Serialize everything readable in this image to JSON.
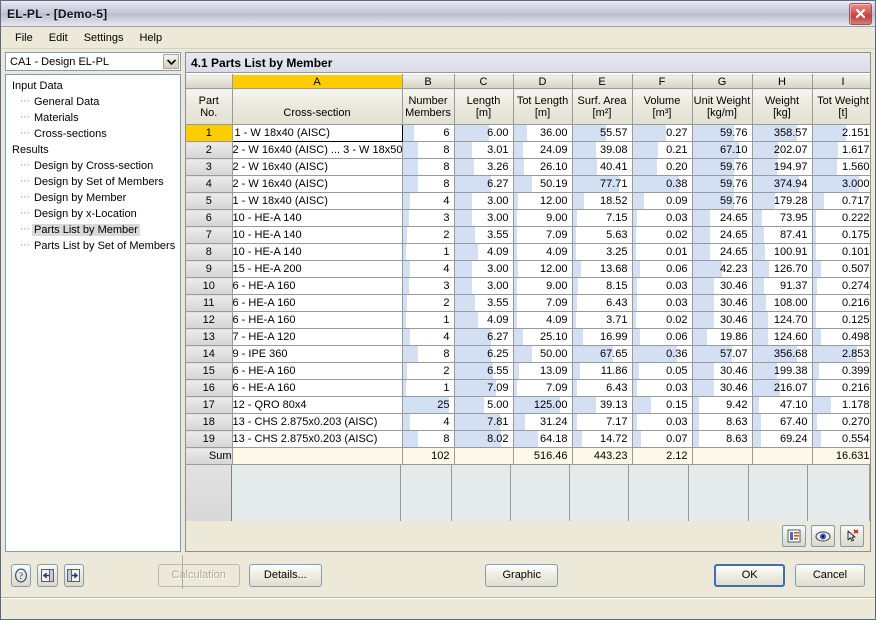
{
  "window": {
    "title": "EL-PL - [Demo-5]",
    "close_icon": "close-icon"
  },
  "menu": {
    "items": [
      "File",
      "Edit",
      "Settings",
      "Help"
    ]
  },
  "sidebar": {
    "combo": {
      "value": "CA1 - Design EL-PL",
      "arrow_icon": "chevron-down-icon"
    },
    "tree": [
      {
        "label": "Input Data",
        "level": 0,
        "selected": false
      },
      {
        "label": "General Data",
        "level": 1,
        "selected": false
      },
      {
        "label": "Materials",
        "level": 1,
        "selected": false
      },
      {
        "label": "Cross-sections",
        "level": 1,
        "selected": false
      },
      {
        "label": "Results",
        "level": 0,
        "selected": false
      },
      {
        "label": "Design by Cross-section",
        "level": 1,
        "selected": false
      },
      {
        "label": "Design by Set of Members",
        "level": 1,
        "selected": false
      },
      {
        "label": "Design by Member",
        "level": 1,
        "selected": false
      },
      {
        "label": "Design by x-Location",
        "level": 1,
        "selected": false
      },
      {
        "label": "Parts List by Member",
        "level": 1,
        "selected": true
      },
      {
        "label": "Parts List by Set of Members",
        "level": 1,
        "selected": false
      }
    ]
  },
  "panel": {
    "header": "4.1 Parts List by Member",
    "toolbar": [
      {
        "name": "print-report-icon"
      },
      {
        "name": "eye-icon"
      },
      {
        "name": "select-cursor-icon"
      }
    ]
  },
  "table": {
    "column_letters": [
      "",
      "A",
      "B",
      "C",
      "D",
      "E",
      "F",
      "G",
      "H",
      "I"
    ],
    "highlight_letter": "A",
    "row_header_title": [
      "Part",
      "No."
    ],
    "headers": [
      {
        "line1": "Cross-section",
        "line2": ""
      },
      {
        "line1": "Number",
        "line2": "Members"
      },
      {
        "line1": "Length",
        "line2": "[m]"
      },
      {
        "line1": "Tot Length",
        "line2": "[m]"
      },
      {
        "line1": "Surf. Area",
        "line2": "[m²]"
      },
      {
        "line1": "Volume",
        "line2": "[m³]"
      },
      {
        "line1": "Unit Weight",
        "line2": "[kg/m]"
      },
      {
        "line1": "Weight",
        "line2": "[kg]"
      },
      {
        "line1": "Tot Weight",
        "line2": "[t]"
      }
    ],
    "rows": [
      {
        "no": "1",
        "cross_section": "1 - W 18x40 (AISC)",
        "number_members": "6",
        "length": "6.00",
        "tot_length": "36.00",
        "surf_area": "55.57",
        "volume": "0.27",
        "unit_weight": "59.76",
        "weight": "358.57",
        "tot_weight": "2.151",
        "active": true
      },
      {
        "no": "2",
        "cross_section": "2 - W 16x40 (AISC) ... 3 - W 18x50",
        "number_members": "8",
        "length": "3.01",
        "tot_length": "24.09",
        "surf_area": "39.08",
        "volume": "0.21",
        "unit_weight": "67.10",
        "weight": "202.07",
        "tot_weight": "1.617",
        "active": false
      },
      {
        "no": "3",
        "cross_section": "2 - W 16x40 (AISC)",
        "number_members": "8",
        "length": "3.26",
        "tot_length": "26.10",
        "surf_area": "40.41",
        "volume": "0.20",
        "unit_weight": "59.76",
        "weight": "194.97",
        "tot_weight": "1.560",
        "active": false
      },
      {
        "no": "4",
        "cross_section": "2 - W 16x40 (AISC)",
        "number_members": "8",
        "length": "6.27",
        "tot_length": "50.19",
        "surf_area": "77.71",
        "volume": "0.38",
        "unit_weight": "59.76",
        "weight": "374.94",
        "tot_weight": "3.000",
        "active": false
      },
      {
        "no": "5",
        "cross_section": "1 - W 18x40 (AISC)",
        "number_members": "4",
        "length": "3.00",
        "tot_length": "12.00",
        "surf_area": "18.52",
        "volume": "0.09",
        "unit_weight": "59.76",
        "weight": "179.28",
        "tot_weight": "0.717",
        "active": false
      },
      {
        "no": "6",
        "cross_section": "10 - HE-A 140",
        "number_members": "3",
        "length": "3.00",
        "tot_length": "9.00",
        "surf_area": "7.15",
        "volume": "0.03",
        "unit_weight": "24.65",
        "weight": "73.95",
        "tot_weight": "0.222",
        "active": false
      },
      {
        "no": "7",
        "cross_section": "10 - HE-A 140",
        "number_members": "2",
        "length": "3.55",
        "tot_length": "7.09",
        "surf_area": "5.63",
        "volume": "0.02",
        "unit_weight": "24.65",
        "weight": "87.41",
        "tot_weight": "0.175",
        "active": false
      },
      {
        "no": "8",
        "cross_section": "10 - HE-A 140",
        "number_members": "1",
        "length": "4.09",
        "tot_length": "4.09",
        "surf_area": "3.25",
        "volume": "0.01",
        "unit_weight": "24.65",
        "weight": "100.91",
        "tot_weight": "0.101",
        "active": false
      },
      {
        "no": "9",
        "cross_section": "15 - HE-A 200",
        "number_members": "4",
        "length": "3.00",
        "tot_length": "12.00",
        "surf_area": "13.68",
        "volume": "0.06",
        "unit_weight": "42.23",
        "weight": "126.70",
        "tot_weight": "0.507",
        "active": false
      },
      {
        "no": "10",
        "cross_section": "6 - HE-A 160",
        "number_members": "3",
        "length": "3.00",
        "tot_length": "9.00",
        "surf_area": "8.15",
        "volume": "0.03",
        "unit_weight": "30.46",
        "weight": "91.37",
        "tot_weight": "0.274",
        "active": false
      },
      {
        "no": "11",
        "cross_section": "6 - HE-A 160",
        "number_members": "2",
        "length": "3.55",
        "tot_length": "7.09",
        "surf_area": "6.43",
        "volume": "0.03",
        "unit_weight": "30.46",
        "weight": "108.00",
        "tot_weight": "0.216",
        "active": false
      },
      {
        "no": "12",
        "cross_section": "6 - HE-A 160",
        "number_members": "1",
        "length": "4.09",
        "tot_length": "4.09",
        "surf_area": "3.71",
        "volume": "0.02",
        "unit_weight": "30.46",
        "weight": "124.70",
        "tot_weight": "0.125",
        "active": false
      },
      {
        "no": "13",
        "cross_section": "7 - HE-A 120",
        "number_members": "4",
        "length": "6.27",
        "tot_length": "25.10",
        "surf_area": "16.99",
        "volume": "0.06",
        "unit_weight": "19.86",
        "weight": "124.60",
        "tot_weight": "0.498",
        "active": false
      },
      {
        "no": "14",
        "cross_section": "9 - IPE 360",
        "number_members": "8",
        "length": "6.25",
        "tot_length": "50.00",
        "surf_area": "67.65",
        "volume": "0.36",
        "unit_weight": "57.07",
        "weight": "356.68",
        "tot_weight": "2.853",
        "active": false
      },
      {
        "no": "15",
        "cross_section": "6 - HE-A 160",
        "number_members": "2",
        "length": "6.55",
        "tot_length": "13.09",
        "surf_area": "11.86",
        "volume": "0.05",
        "unit_weight": "30.46",
        "weight": "199.38",
        "tot_weight": "0.399",
        "active": false
      },
      {
        "no": "16",
        "cross_section": "6 - HE-A 160",
        "number_members": "1",
        "length": "7.09",
        "tot_length": "7.09",
        "surf_area": "6.43",
        "volume": "0.03",
        "unit_weight": "30.46",
        "weight": "216.07",
        "tot_weight": "0.216",
        "active": false
      },
      {
        "no": "17",
        "cross_section": "12 - QRO 80x4",
        "number_members": "25",
        "length": "5.00",
        "tot_length": "125.00",
        "surf_area": "39.13",
        "volume": "0.15",
        "unit_weight": "9.42",
        "weight": "47.10",
        "tot_weight": "1.178",
        "active": false
      },
      {
        "no": "18",
        "cross_section": "13 - CHS 2.875x0.203 (AISC)",
        "number_members": "4",
        "length": "7.81",
        "tot_length": "31.24",
        "surf_area": "7.17",
        "volume": "0.03",
        "unit_weight": "8.63",
        "weight": "67.40",
        "tot_weight": "0.270",
        "active": false
      },
      {
        "no": "19",
        "cross_section": "13 - CHS 2.875x0.203 (AISC)",
        "number_members": "8",
        "length": "8.02",
        "tot_length": "64.18",
        "surf_area": "14.72",
        "volume": "0.07",
        "unit_weight": "8.63",
        "weight": "69.24",
        "tot_weight": "0.554",
        "active": false
      }
    ],
    "sum_row": {
      "no": "Sum",
      "cross_section": "",
      "number_members": "102",
      "length": "",
      "tot_length": "516.46",
      "surf_area": "443.23",
      "volume": "2.12",
      "unit_weight": "",
      "weight": "",
      "tot_weight": "16.631"
    }
  },
  "bottom": {
    "icon_buttons": [
      {
        "name": "help-icon"
      },
      {
        "name": "prev-navigate-icon"
      },
      {
        "name": "next-navigate-icon"
      }
    ],
    "calculation_label": "Calculation",
    "details_label": "Details...",
    "graphic_label": "Graphic",
    "ok_label": "OK",
    "cancel_label": "Cancel"
  },
  "colors": {
    "highlight_yellow": "#ffcc00",
    "data_bar": "#d3dff3",
    "sum_row_bg": "#fdf8e8",
    "default_button_border": "#3c6fb4"
  }
}
